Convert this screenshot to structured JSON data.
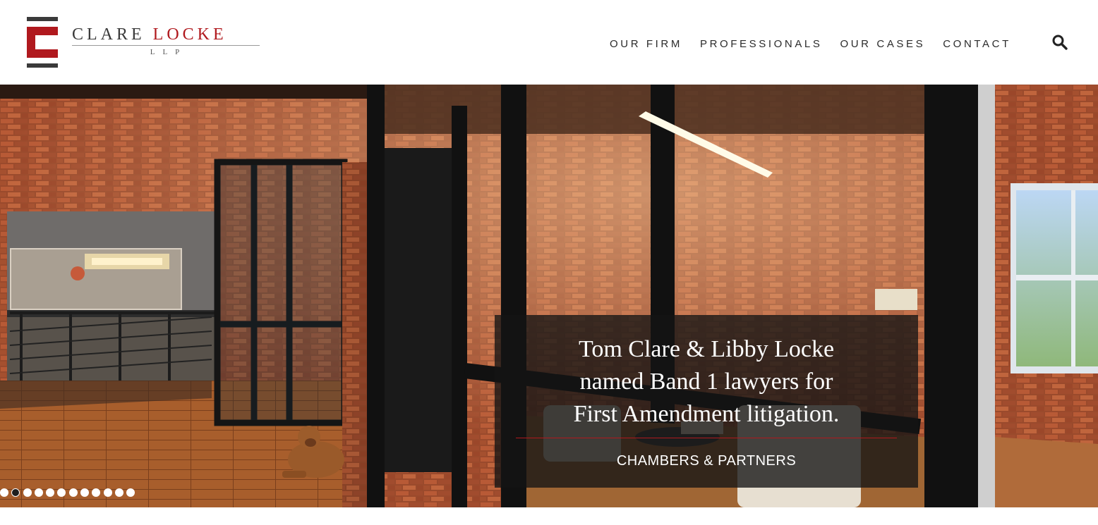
{
  "brand": {
    "name_part1": "CLARE",
    "name_part2": "LOCKE",
    "suffix": "LLP",
    "colors": {
      "red": "#b0191e",
      "dark": "#3a3a3a"
    }
  },
  "nav": {
    "items": [
      {
        "label": "OUR FIRM"
      },
      {
        "label": "PROFESSIONALS"
      },
      {
        "label": "OUR CASES"
      },
      {
        "label": "CONTACT"
      }
    ],
    "search_icon": "search-icon"
  },
  "hero": {
    "headline_lines": [
      "Tom Clare & Libby Locke",
      "named Band 1 lawyers for",
      "First Amendment litigation."
    ],
    "source": "CHAMBERS & PARTNERS",
    "slides": {
      "count": 12,
      "active_index": 1
    }
  }
}
